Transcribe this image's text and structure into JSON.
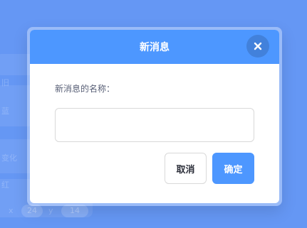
{
  "background": {
    "hint_texts": [
      "旧",
      "蓝",
      "变化",
      "红",
      "x",
      "y"
    ],
    "hint_values": [
      "24",
      "14"
    ]
  },
  "dialog": {
    "title": "新消息",
    "close_icon": "close-icon",
    "field_label": "新消息的名称：",
    "input_value": "",
    "cancel_label": "取消",
    "confirm_label": "确定"
  },
  "colors": {
    "accent": "#4d97ff",
    "overlay": "#6f9df0",
    "text": "#575e75"
  }
}
